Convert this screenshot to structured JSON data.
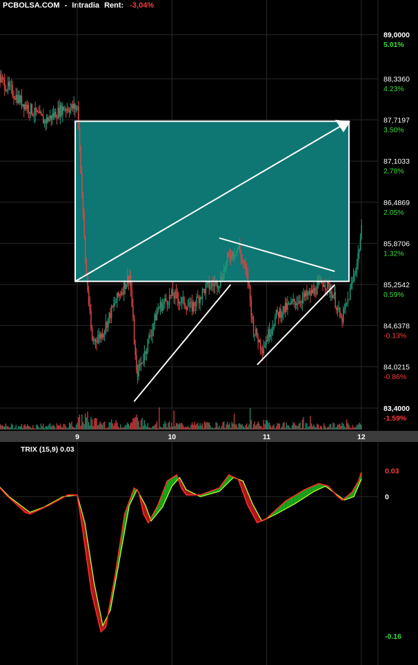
{
  "header": {
    "site": "PCBOLSA.COM",
    "separator": "-",
    "mode": "Intradia",
    "rent_label": "Rent:",
    "rent_value": "-3,04%"
  },
  "colors": {
    "background": "#000000",
    "grid": "#2a2a2a",
    "up_candle": "#1f9c7a",
    "down_candle": "#e04545",
    "box_fill": "#0e7673",
    "line": "#ffffff",
    "positive": "#3ddc3d",
    "negative": "#ff3b3b",
    "trix": "#ff2a2a",
    "signal": "#b4ff2a",
    "axis_bar": "#3c3c3c"
  },
  "chart_data": [
    {
      "type": "candlestick",
      "x_ticks": [
        "9",
        "10",
        "11",
        "12"
      ],
      "price_axis": [
        {
          "price": "89,0000",
          "pct": "5.01%",
          "sign": "pos",
          "bold": true
        },
        {
          "price": "88,3360",
          "pct": "4.23%",
          "sign": "pos",
          "bold": false
        },
        {
          "price": "87,7197",
          "pct": "3.50%",
          "sign": "pos",
          "bold": false
        },
        {
          "price": "87,1033",
          "pct": "2.78%",
          "sign": "pos",
          "bold": false
        },
        {
          "price": "86,4869",
          "pct": "2.05%",
          "sign": "pos",
          "bold": false
        },
        {
          "price": "85,8706",
          "pct": "1.32%",
          "sign": "pos",
          "bold": false
        },
        {
          "price": "85,2542",
          "pct": "0.59%",
          "sign": "pos",
          "bold": false
        },
        {
          "price": "84,6378",
          "pct": "-0.13%",
          "sign": "neg",
          "bold": false
        },
        {
          "price": "84,0215",
          "pct": "-0.86%",
          "sign": "neg",
          "bold": false
        },
        {
          "price": "83,4000",
          "pct": "-1.59%",
          "sign": "neg",
          "bold": true
        }
      ],
      "ylim": [
        83.4,
        89.0
      ],
      "price_path": [
        [
          8.0,
          88.6
        ],
        [
          8.4,
          88.0
        ],
        [
          8.65,
          87.7
        ],
        [
          8.85,
          87.9
        ],
        [
          9.0,
          87.9
        ],
        [
          9.08,
          85.6
        ],
        [
          9.15,
          84.4
        ],
        [
          9.25,
          84.5
        ],
        [
          9.4,
          85.0
        ],
        [
          9.55,
          85.4
        ],
        [
          9.62,
          83.9
        ],
        [
          9.7,
          84.2
        ],
        [
          9.85,
          84.9
        ],
        [
          10.0,
          85.1
        ],
        [
          10.2,
          84.9
        ],
        [
          10.35,
          85.2
        ],
        [
          10.5,
          85.3
        ],
        [
          10.6,
          85.7
        ],
        [
          10.7,
          85.8
        ],
        [
          10.8,
          85.3
        ],
        [
          10.85,
          84.6
        ],
        [
          10.95,
          84.3
        ],
        [
          11.1,
          84.8
        ],
        [
          11.3,
          85.0
        ],
        [
          11.45,
          85.1
        ],
        [
          11.6,
          85.3
        ],
        [
          11.7,
          85.1
        ],
        [
          11.78,
          84.7
        ],
        [
          11.85,
          85.0
        ],
        [
          11.95,
          85.6
        ],
        [
          12.0,
          86.1
        ]
      ],
      "volume_profile": [
        [
          8.0,
          0.3
        ],
        [
          8.9,
          0.3
        ],
        [
          9.0,
          0.6
        ],
        [
          9.05,
          1.0
        ],
        [
          9.1,
          0.9
        ],
        [
          9.2,
          0.6
        ],
        [
          9.5,
          0.4
        ],
        [
          9.62,
          0.8
        ],
        [
          9.7,
          0.5
        ],
        [
          10.0,
          0.4
        ],
        [
          10.7,
          0.4
        ],
        [
          10.9,
          0.5
        ],
        [
          11.5,
          0.3
        ],
        [
          12.0,
          0.4
        ]
      ],
      "annotations": [
        {
          "kind": "rectangle",
          "from": [
            9.0,
            87.7
          ],
          "to": [
            12.0,
            85.3
          ]
        },
        {
          "kind": "arrow",
          "from": [
            9.0,
            85.3
          ],
          "to": [
            12.0,
            87.7
          ]
        },
        {
          "kind": "line",
          "from": [
            10.5,
            85.95
          ],
          "to": [
            11.85,
            85.45
          ]
        },
        {
          "kind": "line",
          "from": [
            9.6,
            83.5
          ],
          "to": [
            10.75,
            85.25
          ]
        },
        {
          "kind": "line",
          "from": [
            10.9,
            84.05
          ],
          "to": [
            11.85,
            85.25
          ]
        }
      ]
    },
    {
      "type": "line",
      "title": "TRIX (15,9) 0.03",
      "y_labels": [
        {
          "value": 0.03,
          "text": "0.03",
          "sign": "neg"
        },
        {
          "value": 0,
          "text": "0",
          "sign": "neutral"
        },
        {
          "value": -0.16,
          "text": "-0.16",
          "sign": "pos"
        }
      ],
      "ylim": [
        -0.167,
        0.035
      ],
      "series": [
        {
          "key": "trix",
          "points": [
            [
              8.0,
              0.026
            ],
            [
              8.1,
              0.02
            ],
            [
              8.25,
              0.002
            ],
            [
              8.45,
              -0.018
            ],
            [
              8.5,
              -0.02
            ],
            [
              8.7,
              -0.01
            ],
            [
              8.9,
              0.002
            ],
            [
              9.0,
              0.002
            ],
            [
              9.06,
              -0.04
            ],
            [
              9.15,
              -0.11
            ],
            [
              9.25,
              -0.155
            ],
            [
              9.3,
              -0.15
            ],
            [
              9.4,
              -0.09
            ],
            [
              9.5,
              -0.02
            ],
            [
              9.6,
              0.01
            ],
            [
              9.65,
              0.005
            ],
            [
              9.7,
              -0.02
            ],
            [
              9.75,
              -0.03
            ],
            [
              9.85,
              -0.01
            ],
            [
              9.95,
              0.018
            ],
            [
              10.05,
              0.025
            ],
            [
              10.1,
              0.01
            ],
            [
              10.15,
              0.002
            ],
            [
              10.3,
              0.002
            ],
            [
              10.5,
              0.01
            ],
            [
              10.6,
              0.025
            ],
            [
              10.7,
              0.02
            ],
            [
              10.8,
              -0.01
            ],
            [
              10.9,
              -0.03
            ],
            [
              11.0,
              -0.025
            ],
            [
              11.2,
              -0.005
            ],
            [
              11.4,
              0.008
            ],
            [
              11.55,
              0.015
            ],
            [
              11.65,
              0.012
            ],
            [
              11.75,
              0.0
            ],
            [
              11.8,
              -0.004
            ],
            [
              11.9,
              0.005
            ],
            [
              11.97,
              0.018
            ],
            [
              12.0,
              0.028
            ]
          ]
        },
        {
          "key": "signal",
          "points": [
            [
              8.0,
              0.024
            ],
            [
              8.12,
              0.018
            ],
            [
              8.28,
              0.0
            ],
            [
              8.5,
              -0.018
            ],
            [
              8.65,
              -0.012
            ],
            [
              8.85,
              0.0
            ],
            [
              9.0,
              0.002
            ],
            [
              9.08,
              -0.03
            ],
            [
              9.18,
              -0.1
            ],
            [
              9.27,
              -0.148
            ],
            [
              9.35,
              -0.13
            ],
            [
              9.45,
              -0.07
            ],
            [
              9.55,
              -0.01
            ],
            [
              9.63,
              0.008
            ],
            [
              9.72,
              -0.01
            ],
            [
              9.78,
              -0.028
            ],
            [
              9.9,
              -0.012
            ],
            [
              10.0,
              0.012
            ],
            [
              10.08,
              0.022
            ],
            [
              10.15,
              0.008
            ],
            [
              10.3,
              0.0
            ],
            [
              10.5,
              0.006
            ],
            [
              10.65,
              0.022
            ],
            [
              10.75,
              0.018
            ],
            [
              10.85,
              -0.008
            ],
            [
              10.95,
              -0.028
            ],
            [
              11.1,
              -0.02
            ],
            [
              11.3,
              -0.008
            ],
            [
              11.5,
              0.006
            ],
            [
              11.62,
              0.012
            ],
            [
              11.72,
              0.004
            ],
            [
              11.82,
              -0.004
            ],
            [
              11.92,
              0.0
            ],
            [
              12.0,
              0.02
            ]
          ]
        }
      ]
    }
  ]
}
